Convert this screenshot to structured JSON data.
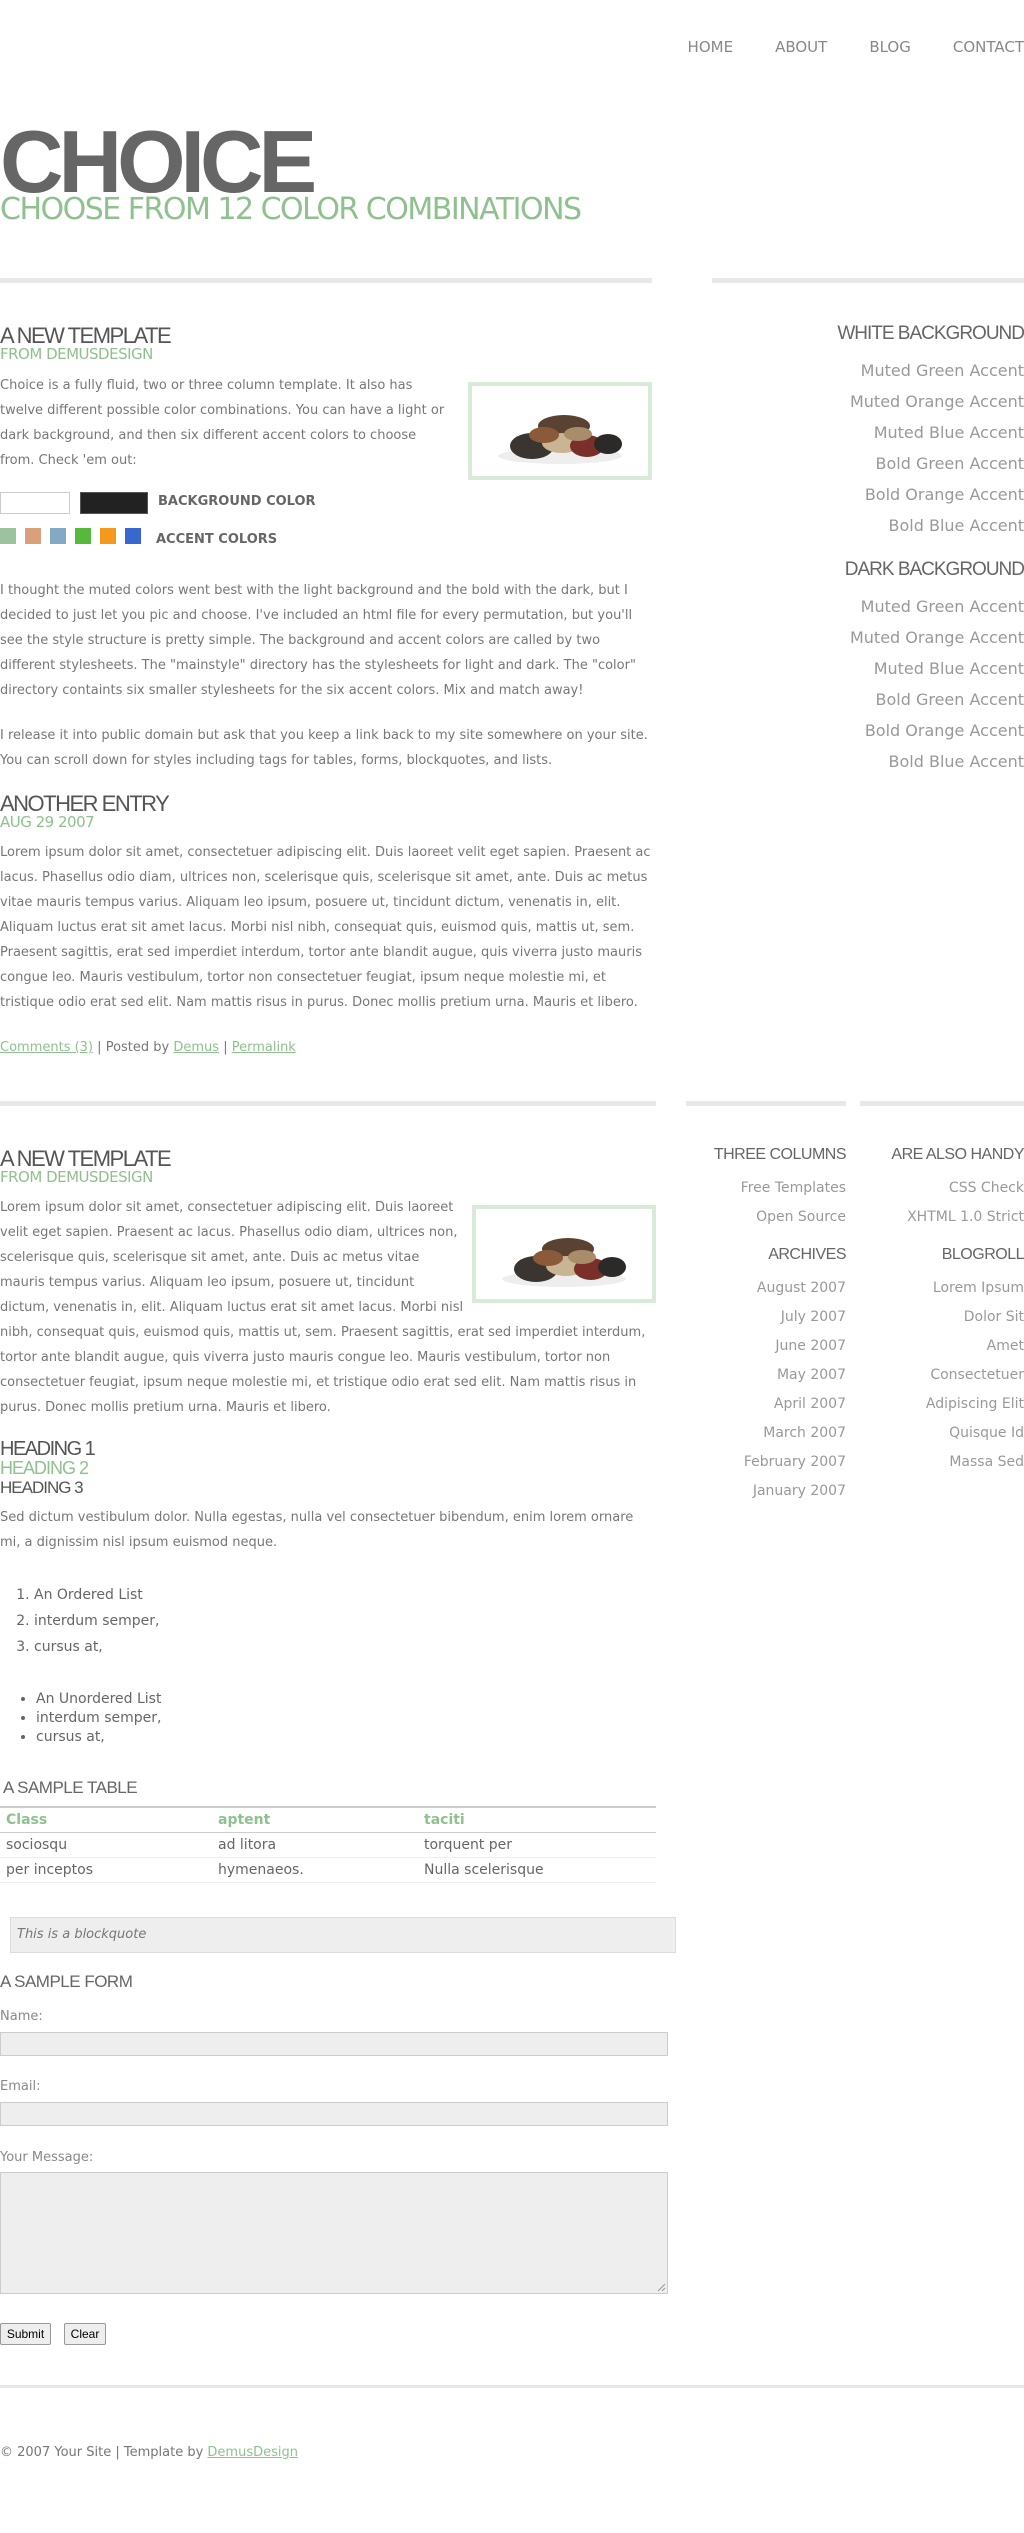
{
  "nav": [
    "HOME",
    "ABOUT",
    "BLOG",
    "CONTACT"
  ],
  "brand": {
    "title": "CHOICE",
    "subtitle": "CHOOSE FROM 12 COLOR COMBINATIONS"
  },
  "post1": {
    "title": "A NEW TEMPLATE",
    "subtitle": "FROM DEMUSDESIGN",
    "intro": "Choice is a fully fluid, two or three column template. It also has twelve different possible color combinations. You can have a light or dark background, and then six different accent colors to choose from. Check 'em out:",
    "background_label": "BACKGROUND COLOR",
    "accent_label": "ACCENT COLORS",
    "accent_colors": [
      "#9cc49c",
      "#d9a07c",
      "#84a9c4",
      "#57b83d",
      "#f39a1c",
      "#3668d0"
    ],
    "para2": "I thought the muted colors went best with the light background and the bold with the dark, but I decided to just let you pic and choose. I've included an html file for every permutation, but you'll see the style structure is pretty simple. The background and accent colors are called by two different stylesheets. The \"mainstyle\" directory has the stylesheets for light and dark. The \"color\" directory containts six smaller stylesheets for the six accent colors. Mix and match away!",
    "para3": "I release it into public domain but ask that you keep a link back to my site somewhere on your site. You can scroll down for styles including tags for tables, forms, blockquotes, and lists."
  },
  "post2": {
    "title": "ANOTHER ENTRY",
    "date": "AUG 29 2007",
    "body": "Lorem ipsum dolor sit amet, consectetuer adipiscing elit. Duis laoreet velit eget sapien. Praesent ac lacus. Phasellus odio diam, ultrices non, scelerisque quis, scelerisque sit amet, ante. Duis ac metus vitae mauris tempus varius. Aliquam leo ipsum, posuere ut, tincidunt dictum, venenatis in, elit. Aliquam luctus erat sit amet lacus. Morbi nisl nibh, consequat quis, euismod quis, mattis ut, sem. Praesent sagittis, erat sed imperdiet interdum, tortor ante blandit augue, quis viverra justo mauris congue leo. Mauris vestibulum, tortor non consectetuer feugiat, ipsum neque molestie mi, et tristique odio erat sed elit. Nam mattis risus in purus. Donec mollis pretium urna. Mauris et libero.",
    "comments": "Comments (3)",
    "sep1": "|",
    "posted_by": "Posted by",
    "author": "Demus",
    "sep2": "|",
    "permalink": "Permalink"
  },
  "sidebar1": {
    "white_heading": "WHITE BACKGROUND",
    "white_items": [
      "Muted Green Accent",
      "Muted Orange Accent",
      "Muted Blue Accent",
      "Bold Green Accent",
      "Bold Orange Accent",
      "Bold Blue Accent"
    ],
    "dark_heading": "DARK BACKGROUND",
    "dark_items": [
      "Muted Green Accent",
      "Muted Orange Accent",
      "Muted Blue Accent",
      "Bold Green Accent",
      "Bold Orange Accent",
      "Bold Blue Accent"
    ]
  },
  "post3": {
    "title": "A NEW TEMPLATE",
    "subtitle": "FROM DEMUSDESIGN",
    "body": "Lorem ipsum dolor sit amet, consectetuer adipiscing elit. Duis laoreet velit eget sapien. Praesent ac lacus. Phasellus odio diam, ultrices non, scelerisque quis, scelerisque sit amet, ante. Duis ac metus vitae mauris tempus varius. Aliquam leo ipsum, posuere ut, tincidunt dictum, venenatis in, elit. Aliquam luctus erat sit amet lacus. Morbi nisl nibh, consequat quis, euismod quis, mattis ut, sem. Praesent sagittis, erat sed imperdiet interdum, tortor ante blandit augue, quis viverra justo mauris congue leo. Mauris vestibulum, tortor non consectetuer feugiat, ipsum neque molestie mi, et tristique odio erat sed elit. Nam mattis risus in purus. Donec mollis pretium urna. Mauris et libero.",
    "h1": "HEADING 1",
    "h2": "HEADING 2",
    "h3": "HEADING 3",
    "para": "Sed dictum vestibulum dolor. Nulla egestas, nulla vel consectetuer bibendum, enim lorem ornare mi, a dignissim nisl ipsum euismod neque.",
    "ordered": [
      "An Ordered List",
      "interdum semper,",
      "cursus at,"
    ],
    "unordered": [
      "An Unordered List",
      "interdum semper,",
      "cursus at,"
    ],
    "table_title": "A SAMPLE TABLE",
    "table": {
      "headers": [
        "Class",
        "aptent",
        "taciti"
      ],
      "rows": [
        [
          "sociosqu",
          "ad litora",
          "torquent per"
        ],
        [
          "per inceptos",
          "hymenaeos.",
          "Nulla scelerisque"
        ]
      ]
    },
    "blockquote": "This is a blockquote",
    "form_title": "A SAMPLE FORM",
    "name_label": "Name:",
    "email_label": "Email:",
    "message_label": "Your Message:",
    "submit": "Submit",
    "clear": "Clear"
  },
  "sidebar2": {
    "col1": {
      "heading": "THREE COLUMNS",
      "items": [
        "Free Templates",
        "Open Source"
      ],
      "archives_heading": "ARCHIVES",
      "archives": [
        "August 2007",
        "July 2007",
        "June 2007",
        "May 2007",
        "April 2007",
        "March 2007",
        "February 2007",
        "January 2007"
      ]
    },
    "col2": {
      "heading": "ARE ALSO HANDY",
      "items": [
        "CSS Check",
        "XHTML 1.0 Strict"
      ],
      "blogroll_heading": "BLOGROLL",
      "blogroll": [
        "Lorem Ipsum",
        "Dolor Sit",
        "Amet",
        "Consectetuer",
        "Adipiscing Elit",
        "Quisque Id",
        "Massa Sed"
      ]
    }
  },
  "footer": {
    "copyright": "© 2007 Your Site",
    "sep": "|",
    "template_by": "Template by",
    "designer": "DemusDesign"
  }
}
